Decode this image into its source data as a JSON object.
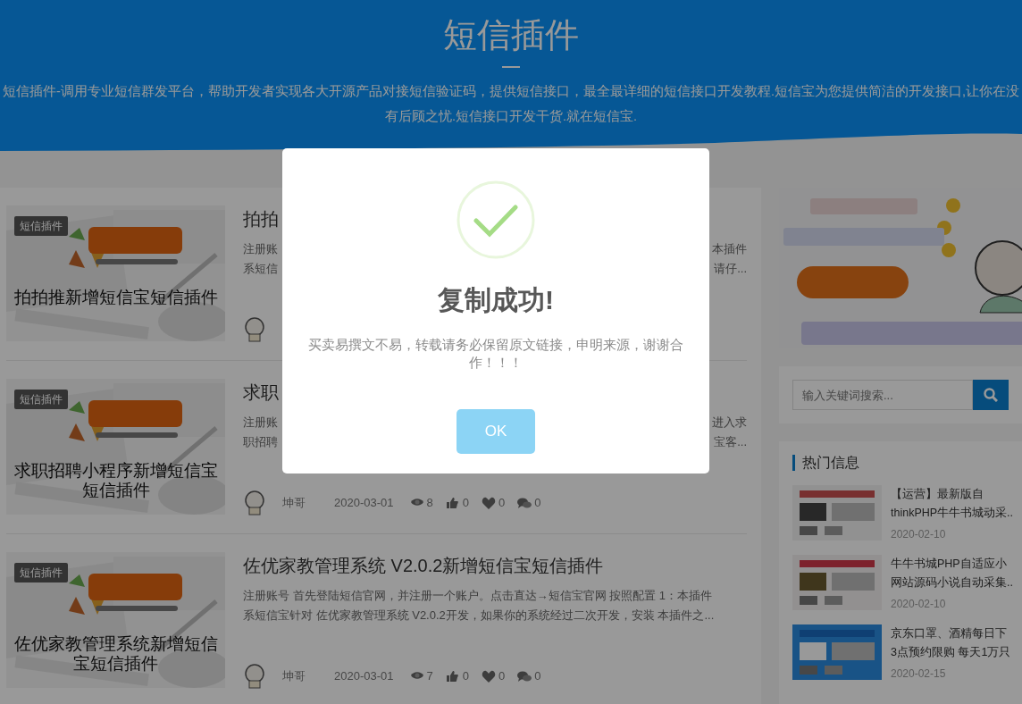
{
  "header": {
    "title": "短信插件",
    "description": "短信插件-调用专业短信群发平台，帮助开发者实现各大开源产品对接短信验证码，提供短信接口，最全最详细的短信接口开发教程.短信宝为您提供简洁的开发接口,让你在没有后顾之忧.短信接口开发干货.就在短信宝."
  },
  "posts": [
    {
      "tag": "短信插件",
      "caption": "拍拍推新增短信宝短信插件",
      "title": "拍拍",
      "excerpt_lines": [
        [
          "注册账",
          "本插件"
        ],
        [
          "系短信",
          "请仔..."
        ]
      ]
    },
    {
      "tag": "短信插件",
      "caption": "求职招聘小程序新增短信宝短信插件",
      "title": "求职",
      "excerpt_lines": [
        [
          "注册账",
          "进入求"
        ],
        [
          "职招聘",
          "宝客..."
        ]
      ],
      "meta": {
        "author": "坤哥",
        "date": "2020-03-01",
        "views": "8",
        "likes": "0",
        "favorites": "0",
        "comments": "0"
      }
    },
    {
      "tag": "短信插件",
      "caption": "佐优家教管理系统新增短信宝短信插件",
      "title": "佐优家教管理系统 V2.0.2新增短信宝短信插件",
      "excerpt_lines": [
        [
          "注册账号 首先登陆短信官网，并注册一个账户。点击直达→短信宝官网 按照配置 1：本插件"
        ],
        [
          "系短信宝针对 佐优家教管理系统 V2.0.2开发，如果你的系统经过二次开发，安装 本插件之..."
        ]
      ],
      "meta": {
        "author": "坤哥",
        "date": "2020-03-01",
        "views": "7",
        "likes": "0",
        "favorites": "0",
        "comments": "0"
      }
    }
  ],
  "sidebar": {
    "search": {
      "placeholder": "输入关键词搜索..."
    },
    "hot": {
      "heading": "热门信息",
      "items": [
        {
          "lines": [
            "【运营】最新版自",
            "thinkPHP牛牛书城动采.."
          ],
          "date": "2020-02-10"
        },
        {
          "lines": [
            "牛牛书城PHP自适应小",
            "网站源码小说自动采集.."
          ],
          "date": "2020-02-10"
        },
        {
          "lines": [
            "京东口罩、酒精每日下",
            "3点预约限购 每天1万只"
          ],
          "date": "2020-02-15"
        }
      ]
    }
  },
  "modal": {
    "title": "复制成功!",
    "message": "买卖易撰文不易，转载请务必保留原文链接，申明来源，谢谢合作！！！",
    "button": "OK"
  }
}
